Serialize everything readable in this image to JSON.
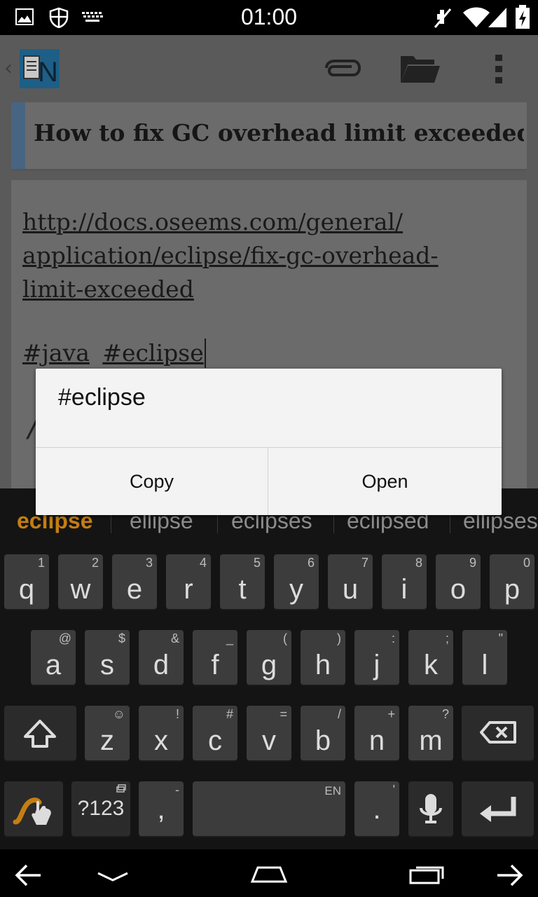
{
  "status_bar": {
    "time": "01:00",
    "left_icons": [
      "picture-icon",
      "shield-icon",
      "keyboard-icon"
    ],
    "right_icons": [
      "mute-icon",
      "wifi-icon",
      "signal-icon",
      "battery-charging-icon"
    ]
  },
  "action_bar": {
    "logo_text": "N",
    "buttons": [
      "paperclip-icon",
      "folder-icon",
      "overflow-menu-icon"
    ]
  },
  "note": {
    "title": "How to fix GC overhead limit exceeded i",
    "link_lines": [
      "http://docs.oseems.com/general/",
      "application/eclipse/fix-gc-overhead-",
      "limit-exceeded"
    ],
    "tags": [
      "#java",
      "#eclipse"
    ]
  },
  "dialog": {
    "title": "#eclipse",
    "copy_label": "Copy",
    "open_label": "Open"
  },
  "keyboard": {
    "suggestions": [
      "eclipse",
      "ellipse",
      "eclipses",
      "eclipsed",
      "ellipses"
    ],
    "row1": [
      {
        "k": "q",
        "h": "1"
      },
      {
        "k": "w",
        "h": "2"
      },
      {
        "k": "e",
        "h": "3"
      },
      {
        "k": "r",
        "h": "4"
      },
      {
        "k": "t",
        "h": "5"
      },
      {
        "k": "y",
        "h": "6"
      },
      {
        "k": "u",
        "h": "7"
      },
      {
        "k": "i",
        "h": "8"
      },
      {
        "k": "o",
        "h": "9"
      },
      {
        "k": "p",
        "h": "0"
      }
    ],
    "row2": [
      {
        "k": "a",
        "h": "@"
      },
      {
        "k": "s",
        "h": "$"
      },
      {
        "k": "d",
        "h": "&"
      },
      {
        "k": "f",
        "h": "_"
      },
      {
        "k": "g",
        "h": "("
      },
      {
        "k": "h",
        "h": ")"
      },
      {
        "k": "j",
        "h": ":"
      },
      {
        "k": "k",
        "h": ";"
      },
      {
        "k": "l",
        "h": "\""
      }
    ],
    "row3": [
      {
        "k": "z",
        "h": "☺"
      },
      {
        "k": "x",
        "h": "!"
      },
      {
        "k": "c",
        "h": "#"
      },
      {
        "k": "v",
        "h": "="
      },
      {
        "k": "b",
        "h": "/"
      },
      {
        "k": "n",
        "h": "+"
      },
      {
        "k": "m",
        "h": "?"
      }
    ],
    "symbols_label": "?123",
    "comma_label": ",",
    "comma_hint": "-",
    "space_hint": "EN",
    "period_label": ".",
    "period_hint": "'"
  },
  "nav_bar": {
    "buttons": [
      "back-icon",
      "hide-keyboard-icon",
      "home-icon",
      "recents-icon",
      "forward-icon"
    ]
  }
}
